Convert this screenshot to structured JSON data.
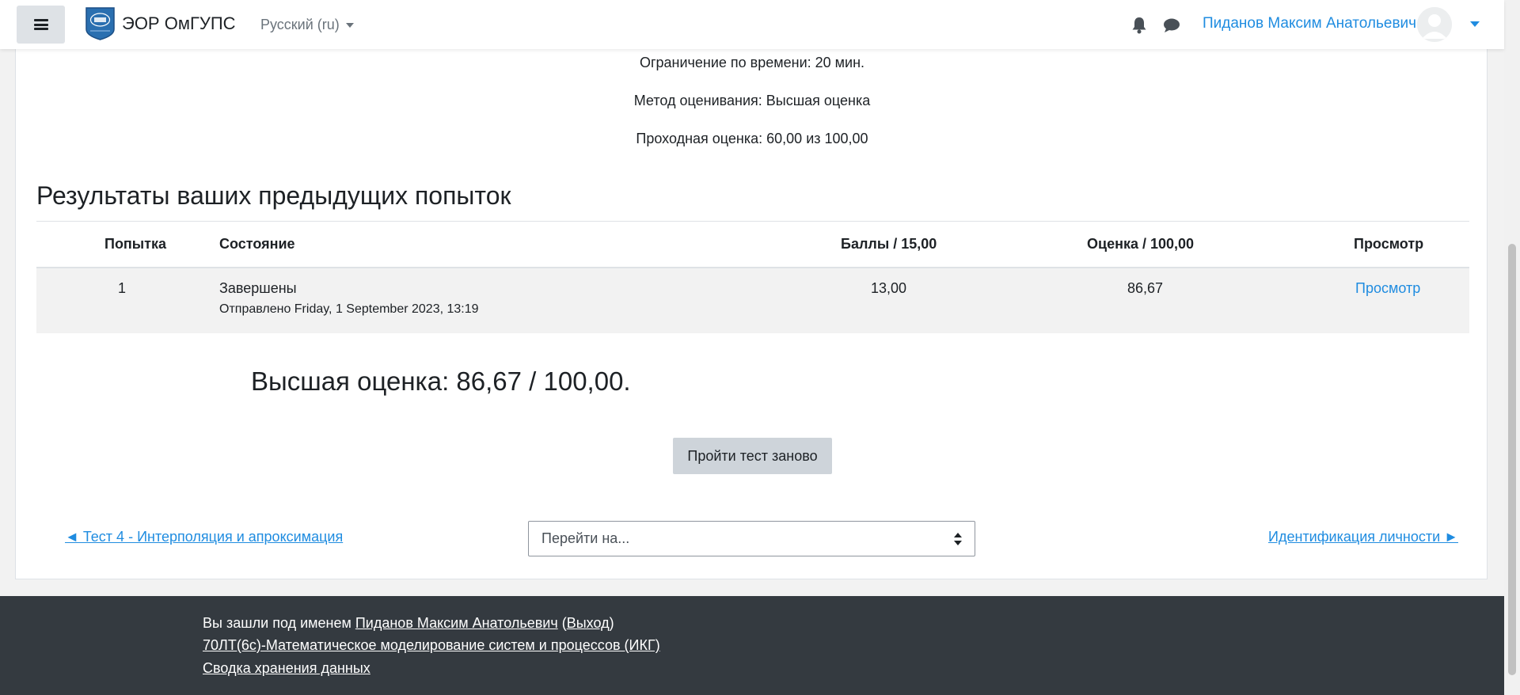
{
  "navbar": {
    "brand": "ЭОР ОмГУПС",
    "language": "Русский (ru)",
    "user_name": "Пиданов Максим Анатольевич"
  },
  "quiz_info": {
    "time_limit": "Ограничение по времени: 20 мин.",
    "grading_method": "Метод оценивания: Высшая оценка",
    "passing_grade": "Проходная оценка: 60,00 из 100,00"
  },
  "attempts": {
    "title": "Результаты ваших предыдущих попыток",
    "columns": {
      "attempt": "Попытка",
      "state": "Состояние",
      "marks": "Баллы / 15,00",
      "grade": "Оценка / 100,00",
      "review": "Просмотр"
    },
    "rows": [
      {
        "attempt": "1",
        "state": "Завершены",
        "submitted": "Отправлено Friday, 1 September 2023, 13:19",
        "marks": "13,00",
        "grade": "86,67",
        "review": "Просмотр"
      }
    ]
  },
  "best_grade": "Высшая оценка: 86,67 / 100,00.",
  "retry_button": "Пройти тест заново",
  "navigation": {
    "prev": "◄ Тест 4 - Интерполяция и апроксимация",
    "jump_placeholder": "Перейти на...",
    "next": "Идентификация личности ►"
  },
  "footer": {
    "logged_in_prefix": "Вы зашли под именем",
    "user_link": "Пиданов Максим Анатольевич",
    "logout_open": "(",
    "logout_link": "Выход",
    "logout_close": ")",
    "course_link": "70ЛТ(6с)-Математическое моделирование систем и процессов (ИКГ)",
    "data_retention_link": "Сводка хранения данных"
  },
  "colors": {
    "link": "#1f8ce0",
    "footer_bg": "#343a40",
    "button_bg": "#ced4da"
  }
}
